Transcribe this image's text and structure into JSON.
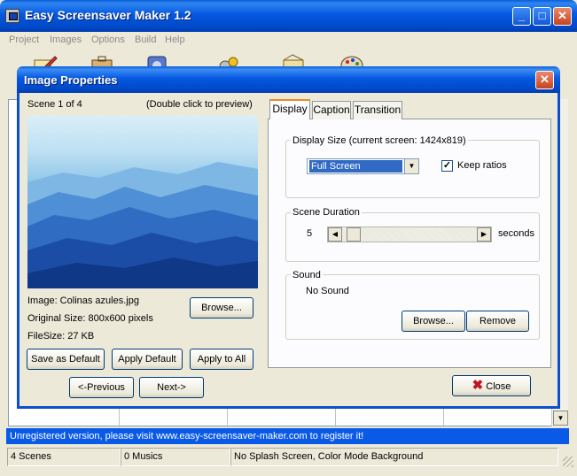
{
  "window": {
    "title": "Easy Screensaver Maker 1.2",
    "minimize": "_",
    "maximize": "□",
    "close": "✕"
  },
  "menu": [
    "Project",
    "Images",
    "Options",
    "Build",
    "Help"
  ],
  "toolbar_icons": [
    "pencil-icon",
    "briefcase-icon",
    "disk-icon",
    "gears-icon",
    "image-edit-icon",
    "palette-icon"
  ],
  "dialog": {
    "title": "Image Properties",
    "close": "✕",
    "scene_label": "Scene 1 of 4",
    "preview_hint": "(Double click to preview)",
    "image_name": "Image: Colinas azules.jpg",
    "original_size": "Original Size: 800x600 pixels",
    "file_size": "FileSize: 27 KB",
    "browse": "Browse...",
    "save_default": "Save as Default",
    "apply_default": "Apply Default",
    "apply_all": "Apply to All",
    "previous": "<-Previous",
    "next": "Next->",
    "close_button": "Close",
    "tabs": [
      "Display",
      "Caption",
      "Transition"
    ],
    "display": {
      "group_title": "Display Size (current screen: 1424x819)",
      "select_value": "Full Screen",
      "keep_ratios_label": "Keep ratios",
      "keep_ratios_checked": true
    },
    "duration": {
      "group_title": "Scene Duration",
      "value": "5",
      "unit": "seconds",
      "slider_fraction": 0.04
    },
    "sound": {
      "group_title": "Sound",
      "value": "No Sound",
      "browse": "Browse...",
      "remove": "Remove"
    }
  },
  "unregistered_text": "Unregistered version, please visit www.easy-screensaver-maker.com to register it!",
  "status": {
    "scenes": "4 Scenes",
    "musics": "0 Musics",
    "info": "No Splash Screen, Color Mode Background"
  },
  "colors": {
    "titlebar": "#0558e0",
    "selection": "#316ac5",
    "close_icon": "#c0161e"
  }
}
